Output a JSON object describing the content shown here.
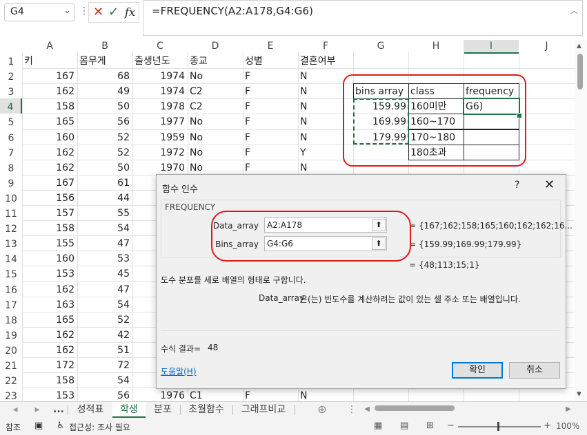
{
  "formula_bar": {
    "name_box": "G4",
    "formula": "=FREQUENCY(A2:A178,G4:G6)",
    "separator": "⋮",
    "cancel_symbol": "✕",
    "enter_symbol": "✓",
    "fx_symbol": "fx"
  },
  "columns": [
    "A",
    "B",
    "C",
    "D",
    "E",
    "F",
    "G",
    "H",
    "I",
    "J"
  ],
  "rows": [
    {
      "n": "1",
      "A": "키",
      "B": "몸무게",
      "C": "출생년도",
      "D": "종교",
      "E": "성별",
      "F": "결혼여부"
    },
    {
      "n": "2",
      "A": "167",
      "B": "68",
      "C": "1974",
      "D": "No",
      "E": "F",
      "F": "N"
    },
    {
      "n": "3",
      "A": "162",
      "B": "49",
      "C": "1974",
      "D": "C2",
      "E": "F",
      "F": "N"
    },
    {
      "n": "4",
      "A": "158",
      "B": "50",
      "C": "1978",
      "D": "C2",
      "E": "F",
      "F": "N"
    },
    {
      "n": "5",
      "A": "165",
      "B": "56",
      "C": "1977",
      "D": "No",
      "E": "F",
      "F": "N"
    },
    {
      "n": "6",
      "A": "160",
      "B": "52",
      "C": "1959",
      "D": "No",
      "E": "F",
      "F": "N"
    },
    {
      "n": "7",
      "A": "162",
      "B": "52",
      "C": "1972",
      "D": "No",
      "E": "F",
      "F": "Y"
    },
    {
      "n": "8",
      "A": "162",
      "B": "50",
      "C": "1970",
      "D": "No",
      "E": "F",
      "F": "N"
    },
    {
      "n": "9",
      "A": "167",
      "B": "61"
    },
    {
      "n": "10",
      "A": "156",
      "B": "44"
    },
    {
      "n": "11",
      "A": "157",
      "B": "55"
    },
    {
      "n": "12",
      "A": "158",
      "B": "54"
    },
    {
      "n": "13",
      "A": "155",
      "B": "47"
    },
    {
      "n": "14",
      "A": "160",
      "B": "53"
    },
    {
      "n": "15",
      "A": "153",
      "B": "45"
    },
    {
      "n": "16",
      "A": "162",
      "B": "47"
    },
    {
      "n": "17",
      "A": "163",
      "B": "54"
    },
    {
      "n": "18",
      "A": "165",
      "B": "52"
    },
    {
      "n": "19",
      "A": "162",
      "B": "42"
    },
    {
      "n": "20",
      "A": "162",
      "B": "51"
    },
    {
      "n": "21",
      "A": "172",
      "B": "72"
    },
    {
      "n": "22",
      "A": "158",
      "B": "54"
    },
    {
      "n": "23",
      "A": "153",
      "B": "56",
      "C": "1976",
      "D": "C1",
      "E": "F",
      "F": "N"
    }
  ],
  "freq_table": {
    "headers": [
      "bins array",
      "class",
      "frequency"
    ],
    "bins": [
      "159.99",
      "169.99",
      "179.99"
    ],
    "classes": [
      "160미만",
      "160~170",
      "170~180",
      "180초과"
    ],
    "editing_text": "G6)"
  },
  "dialog": {
    "title": "함수 인수",
    "help_symbol": "?",
    "close_symbol": "✕",
    "function_name": "FREQUENCY",
    "args": [
      {
        "label": "Data_array",
        "value": "A2:A178",
        "result": "{167;162;158;165;160;162;162;16..."
      },
      {
        "label": "Bins_array",
        "value": "G4:G6",
        "result": "{159.99;169.99;179.99}"
      }
    ],
    "equals": "=",
    "overall_result": "{48;113;15;1}",
    "description": "도수 분포를 세로 배열의 형태로 구합니다.",
    "arg_help_name": "Data_array",
    "arg_help_text": "은(는) 빈도수를 계산하려는 값이 있는 셀 주소 또는 배열입니다.",
    "formula_result_label": "수식 결과=",
    "formula_result_value": "48",
    "help_link": "도움말(H)",
    "ok_label": "확인",
    "cancel_label": "취소"
  },
  "sheet_tabs": {
    "nav_prev": "◂",
    "nav_next": "▸",
    "more": "...",
    "tabs": [
      "성적표",
      "학생",
      "분포",
      "초월함수",
      "그래프비교"
    ],
    "active_index": 1,
    "add_symbol": "⊕",
    "options_symbol": "⋮"
  },
  "status_bar": {
    "mode": "참조",
    "accessibility": "접근성: 조사 필요",
    "zoom": "100%"
  },
  "colors": {
    "excel_green": "#1f7244",
    "annotation_red": "#e01818",
    "link_blue": "#0066cc"
  }
}
